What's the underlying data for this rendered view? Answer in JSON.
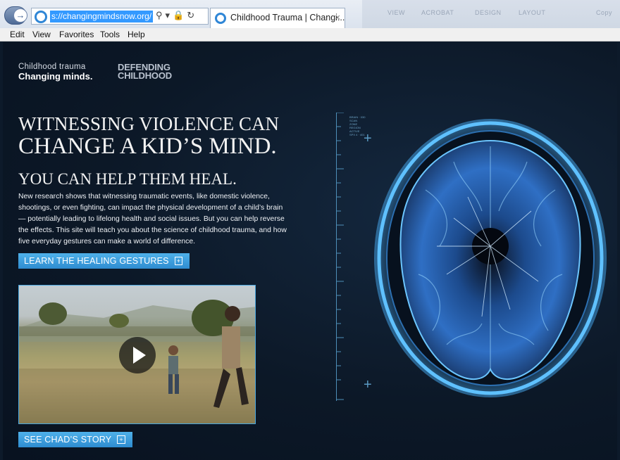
{
  "browser": {
    "url": "s://changingmindsnow.org/",
    "tab_title": "Childhood Trauma | Changi...",
    "tab_close": "×",
    "back_glyph": "→",
    "address_tools": "⚲▾🔒↻",
    "background_items": [
      "VIEW",
      "ACROBAT",
      "DESIGN",
      "LAYOUT",
      "Copy"
    ],
    "menu": [
      "Edit",
      "View",
      "Favorites",
      "Tools",
      "Help"
    ]
  },
  "page": {
    "logo_line1": "Childhood trauma",
    "logo_line2": "Changing minds.",
    "logo2_line1": "DEFENDING",
    "logo2_line2": "CHILDHOOD",
    "headline_line1": "WITNESSING VIOLENCE CAN",
    "headline_line2": "CHANGE A KID’S MIND.",
    "subheadline": "YOU CAN HELP THEM HEAL.",
    "body": "New research shows that witnessing traumatic events, like domestic violence, shootings, or even fighting, can impact the physical development of a child’s brain — potentially leading to lifelong health and social issues. But you can help reverse the effects. This site will teach you about the science of childhood trauma, and how five everyday gestures can make a world of difference.",
    "cta_gestures": "LEARN THE HEALING GESTURES",
    "cta_story": "SEE CHAD’S STORY",
    "plus": "+",
    "scale_labels": [
      "BRAIN · 030",
      "SCAN",
      "ZONE",
      "REGION",
      "ACTIVE",
      "SPX 4 · 401"
    ]
  },
  "colors": {
    "accent": "#3a9ee0",
    "background": "#0c1827",
    "brain": "#2f6fc4"
  },
  "icons": [
    "back-arrow-icon",
    "ie-logo-icon",
    "search-icon",
    "lock-icon",
    "refresh-icon",
    "play-icon",
    "brain-scan-illustration"
  ]
}
